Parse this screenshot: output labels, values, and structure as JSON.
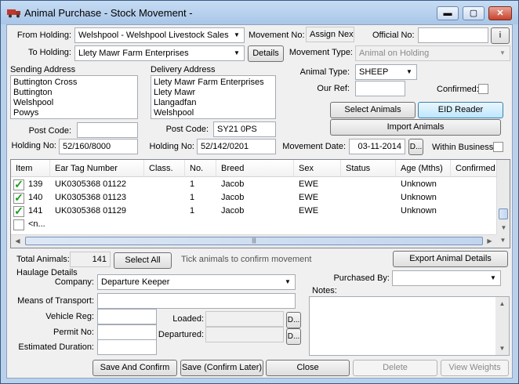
{
  "window": {
    "title": "Animal Purchase - Stock Movement -",
    "controls": {
      "minimize": "▬",
      "maximize": "▢",
      "close": "✕"
    }
  },
  "from_holding": {
    "label": "From Holding:",
    "value": "Welshpool - Welshpool Livestock Sales"
  },
  "to_holding": {
    "label": "To Holding:",
    "value": "Llety Mawr Farm Enterprises",
    "details_button": "Details"
  },
  "movement_no": {
    "label": "Movement No:",
    "button": "Assign Next"
  },
  "official_no": {
    "label": "Official No:",
    "value": "",
    "info_button": "i"
  },
  "movement_type": {
    "label": "Movement Type:",
    "value": "Animal on Holding"
  },
  "animal_type": {
    "label": "Animal Type:",
    "value": "SHEEP"
  },
  "our_ref": {
    "label": "Our Ref:",
    "value": ""
  },
  "confirmed": {
    "label": "Confirmed:",
    "checked": false
  },
  "sending_address": {
    "label": "Sending Address",
    "lines": [
      "Buttington Cross",
      "Buttington",
      "Welshpool",
      "Powys"
    ],
    "post_code_label": "Post Code:",
    "post_code": "",
    "holding_no_label": "Holding No:",
    "holding_no": "52/160/8000"
  },
  "delivery_address": {
    "label": "Delivery Address",
    "lines": [
      "Llety Mawr Farm Enterprises",
      "Llety Mawr",
      "Llangadfan",
      "Welshpool"
    ],
    "post_code_label": "Post Code:",
    "post_code": "SY21 0PS",
    "holding_no_label": "Holding No:",
    "holding_no": "52/142/0201"
  },
  "buttons": {
    "select_animals": "Select Animals",
    "eid_reader": "EID Reader",
    "import_animals": "Import Animals",
    "select_all": "Select All",
    "export_details": "Export Animal Details",
    "save_and_confirm": "Save And Confirm",
    "save_confirm_later": "Save (Confirm Later)",
    "close": "Close",
    "delete": "Delete",
    "view_weights": "View Weights"
  },
  "movement_date": {
    "label": "Movement Date:",
    "value": "03-11-2014",
    "picker": "D..."
  },
  "within_business": {
    "label": "Within Business",
    "checked": false
  },
  "grid": {
    "columns": [
      "Item",
      "Ear Tag Number",
      "Class.",
      "No.",
      "Breed",
      "Sex",
      "Status",
      "Age (Mths)",
      "Confirmed"
    ],
    "rows": [
      {
        "item": "139",
        "tag": "UK0305368 01122",
        "class": "",
        "no": "1",
        "breed": "Jacob",
        "sex": "EWE",
        "status": "",
        "age": "Unknown",
        "confirmed": "",
        "checked": true
      },
      {
        "item": "140",
        "tag": "UK0305368 01123",
        "class": "",
        "no": "1",
        "breed": "Jacob",
        "sex": "EWE",
        "status": "",
        "age": "Unknown",
        "confirmed": "",
        "checked": true
      },
      {
        "item": "141",
        "tag": "UK0305368 01129",
        "class": "",
        "no": "1",
        "breed": "Jacob",
        "sex": "EWE",
        "status": "",
        "age": "Unknown",
        "confirmed": "",
        "checked": true
      }
    ],
    "new_row": "<n...",
    "hscroll_thumb": "|||"
  },
  "totals": {
    "label": "Total Animals:",
    "value": "141",
    "hint": "Tick animals to confirm movement"
  },
  "haulage": {
    "group_label": "Haulage Details",
    "company_label": "Company:",
    "company": "Departure Keeper",
    "means_label": "Means of Transport:",
    "means": "",
    "vehicle_label": "Vehicle Reg:",
    "vehicle": "",
    "permit_label": "Permit No:",
    "permit": "",
    "duration_label": "Estimated Duration:",
    "duration": "",
    "loaded_label": "Loaded:",
    "loaded": "",
    "departured_label": "Departured:",
    "departured": "",
    "picker": "D..."
  },
  "purchased_by": {
    "label": "Purchased By:",
    "value": ""
  },
  "notes": {
    "label": "Notes:",
    "value": ""
  }
}
